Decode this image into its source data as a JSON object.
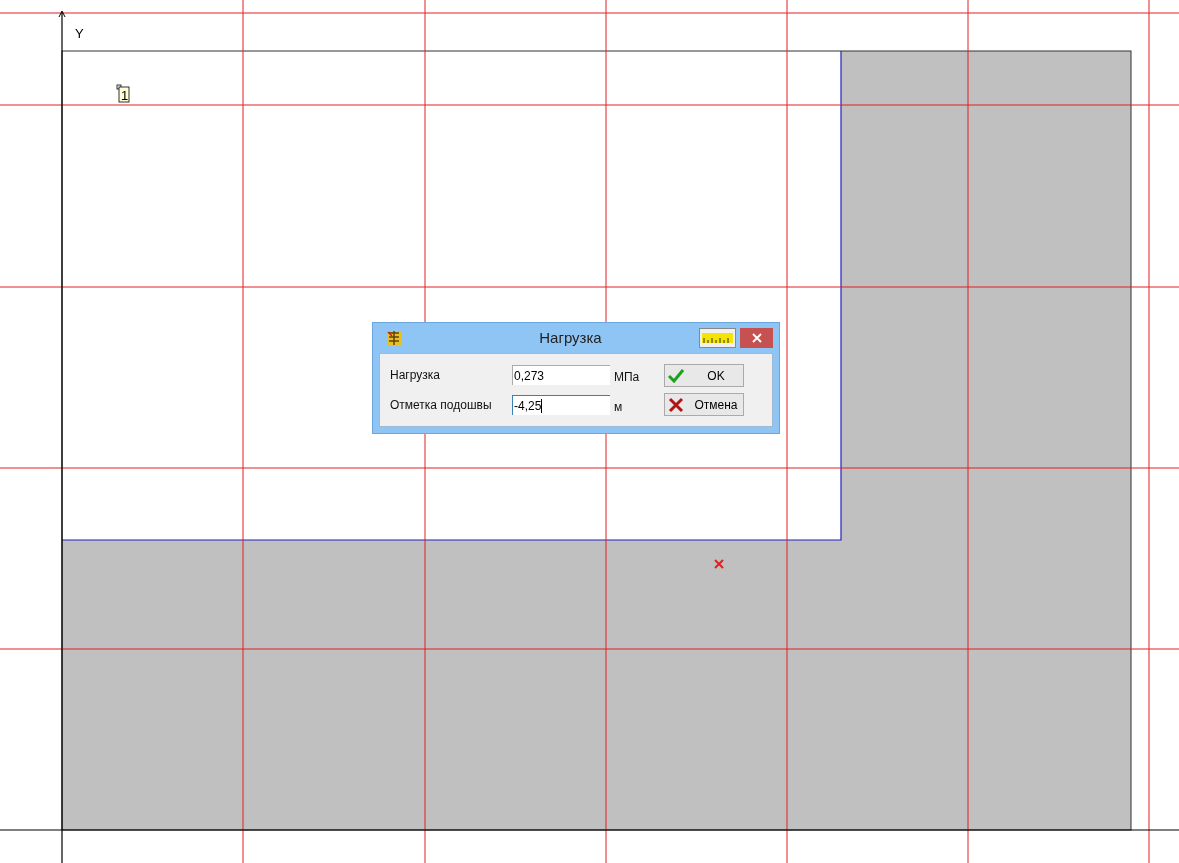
{
  "canvas": {
    "axis_label": "Y",
    "node_label": "1"
  },
  "dialog": {
    "title": "Нагрузка",
    "fields": [
      {
        "label": "Нагрузка",
        "value": "0,273",
        "unit": "МПа",
        "focused": false
      },
      {
        "label": "Отметка подошвы",
        "value": "-4,25",
        "unit": "м",
        "focused": true
      }
    ],
    "buttons": [
      {
        "kind": "ok",
        "label": "OK"
      },
      {
        "kind": "cancel",
        "label": "Отмена"
      }
    ]
  }
}
